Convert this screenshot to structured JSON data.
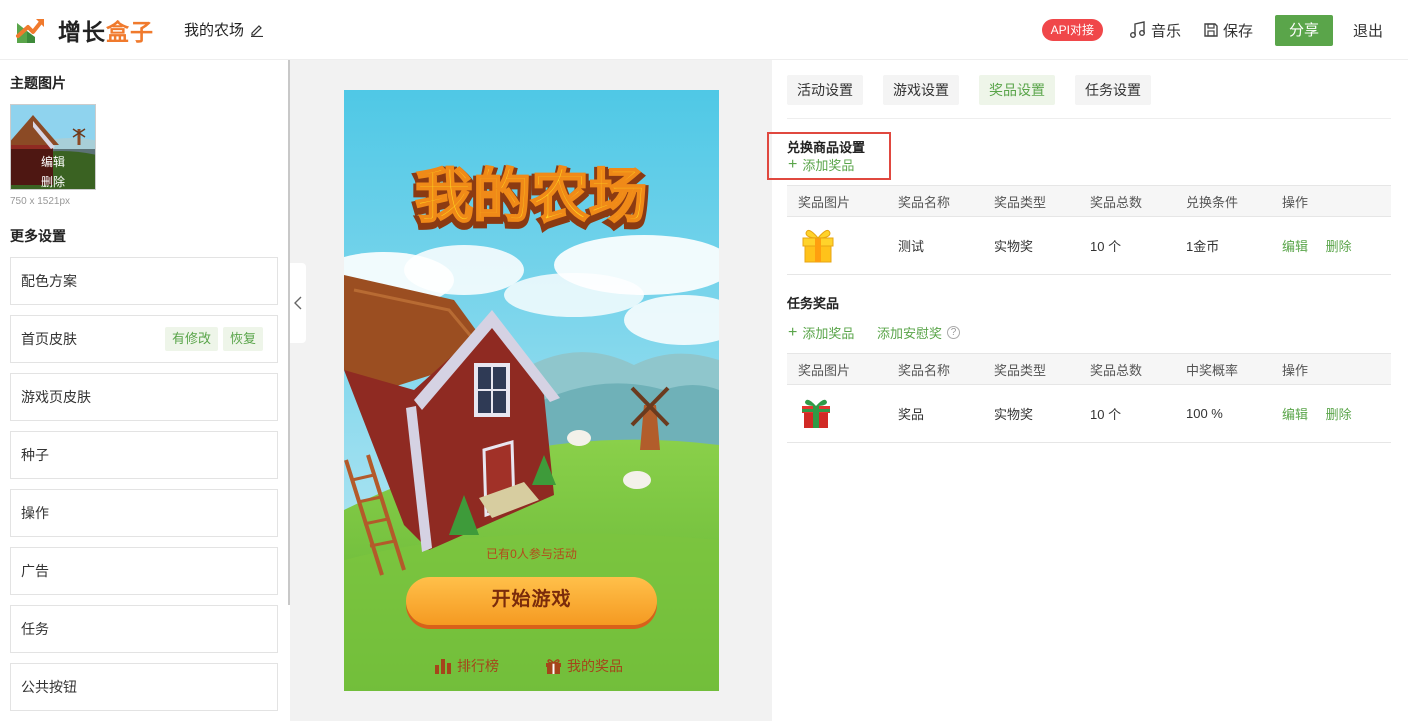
{
  "header": {
    "logo": {
      "part1": "增长",
      "part2": "盒子"
    },
    "project_title": "我的农场",
    "api_badge": "API对接",
    "music": "音乐",
    "save": "保存",
    "share": "分享",
    "logout": "退出"
  },
  "left": {
    "theme_title": "主题图片",
    "thumb_edit": "编辑",
    "thumb_delete": "删除",
    "thumb_size": "750 x 1521px",
    "more_title": "更多设置",
    "items": [
      {
        "label": "配色方案"
      },
      {
        "label": "首页皮肤",
        "tags": [
          "有修改",
          "恢复"
        ]
      },
      {
        "label": "游戏页皮肤"
      },
      {
        "label": "种子"
      },
      {
        "label": "操作"
      },
      {
        "label": "广告"
      },
      {
        "label": "任务"
      },
      {
        "label": "公共按钮"
      }
    ]
  },
  "preview": {
    "game_title": "我的农场",
    "participants": "已有0人参与活动",
    "start_button": "开始游戏",
    "ranking": "排行榜",
    "my_prizes": "我的奖品"
  },
  "right": {
    "tabs": [
      "活动设置",
      "游戏设置",
      "奖品设置",
      "任务设置"
    ],
    "active_tab": "奖品设置",
    "exchange": {
      "title": "兑换商品设置",
      "add": "添加奖品",
      "headers": [
        "奖品图片",
        "奖品名称",
        "奖品类型",
        "奖品总数",
        "兑换条件",
        "操作"
      ],
      "rows": [
        {
          "icon": "gift-box-yellow-icon",
          "name": "测试",
          "type": "实物奖",
          "total": "10 个",
          "condition": "1金币",
          "edit": "编辑",
          "delete": "删除"
        }
      ]
    },
    "task": {
      "title": "任务奖品",
      "add": "添加奖品",
      "add_consolation": "添加安慰奖",
      "headers": [
        "奖品图片",
        "奖品名称",
        "奖品类型",
        "奖品总数",
        "中奖概率",
        "操作"
      ],
      "rows": [
        {
          "icon": "gift-box-red-icon",
          "name": "奖品",
          "type": "实物奖",
          "total": "10 个",
          "probability": "100 %",
          "edit": "编辑",
          "delete": "删除"
        }
      ]
    }
  },
  "colors": {
    "accent_green": "#5aa54a",
    "badge_red": "#f0474a",
    "logo_orange": "#f07a2d",
    "highlight_red": "#e0483f"
  }
}
